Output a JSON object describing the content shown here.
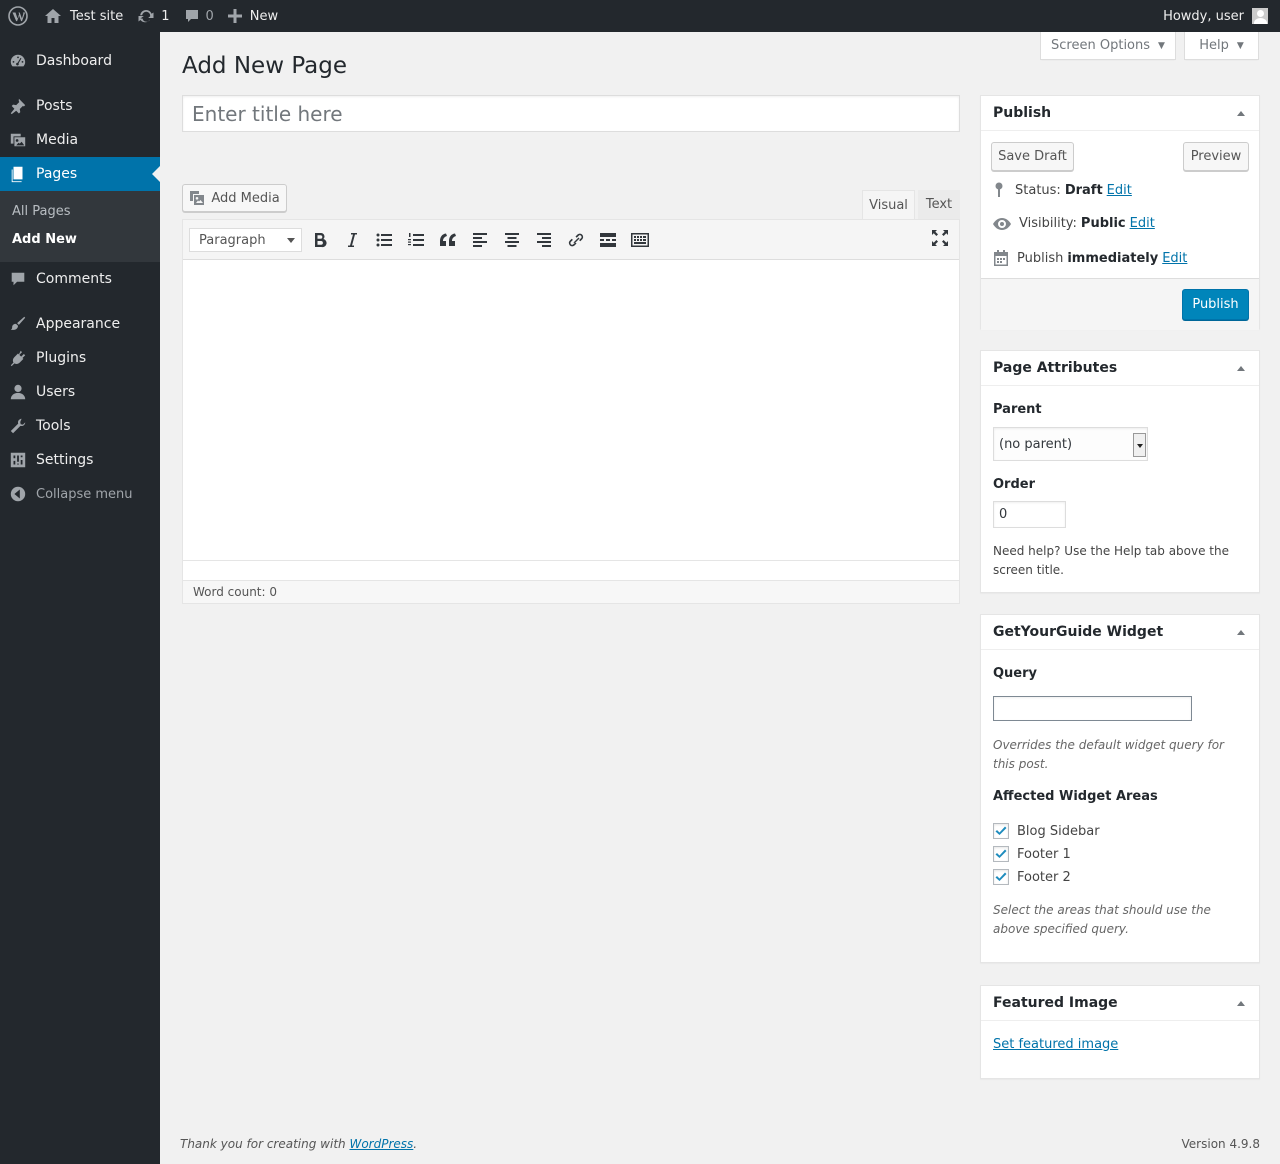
{
  "adminbar": {
    "site_name": "Test site",
    "updates_count": "1",
    "comments_count": "0",
    "new_label": "New",
    "howdy": "Howdy, user"
  },
  "sidebar": {
    "items": [
      {
        "label": "Dashboard",
        "icon": "dashboard-icon"
      },
      {
        "label": "Posts",
        "icon": "pushpin-icon"
      },
      {
        "label": "Media",
        "icon": "media-icon"
      },
      {
        "label": "Pages",
        "icon": "pages-icon",
        "current": true
      },
      {
        "label": "Comments",
        "icon": "comment-icon"
      },
      {
        "label": "Appearance",
        "icon": "paintbrush-icon"
      },
      {
        "label": "Plugins",
        "icon": "plug-icon"
      },
      {
        "label": "Users",
        "icon": "user-icon"
      },
      {
        "label": "Tools",
        "icon": "wrench-icon"
      },
      {
        "label": "Settings",
        "icon": "settings-icon"
      }
    ],
    "submenu": {
      "all_pages": "All Pages",
      "add_new": "Add New"
    },
    "collapse": "Collapse menu"
  },
  "screen_options": "Screen Options",
  "help": "Help",
  "page_title": "Add New Page",
  "title_placeholder": "Enter title here",
  "editor": {
    "add_media": "Add Media",
    "tab_visual": "Visual",
    "tab_text": "Text",
    "format": "Paragraph",
    "word_count": "Word count: 0"
  },
  "publish_box": {
    "title": "Publish",
    "save_draft": "Save Draft",
    "preview": "Preview",
    "status_label": "Status:",
    "status_value": "Draft",
    "visibility_label": "Visibility:",
    "visibility_value": "Public",
    "publish_label": "Publish",
    "publish_value": "immediately",
    "edit": "Edit",
    "publish_button": "Publish"
  },
  "page_attributes": {
    "title": "Page Attributes",
    "parent_label": "Parent",
    "parent_value": "(no parent)",
    "order_label": "Order",
    "order_value": "0",
    "help": "Need help? Use the Help tab above the screen title."
  },
  "gyg_widget": {
    "title": "GetYourGuide Widget",
    "query_label": "Query",
    "query_value": "",
    "query_help": "Overrides the default widget query for this post.",
    "areas_label": "Affected Widget Areas",
    "areas": [
      {
        "label": "Blog Sidebar",
        "checked": true
      },
      {
        "label": "Footer 1",
        "checked": true
      },
      {
        "label": "Footer 2",
        "checked": true
      }
    ],
    "areas_help": "Select the areas that should use the above specified query."
  },
  "featured_image": {
    "title": "Featured Image",
    "link": "Set featured image"
  },
  "footer": {
    "thanks": "Thank you for creating with",
    "wordpress": "WordPress",
    "version": "Version 4.9.8"
  },
  "colors": {
    "accent": "#0073aa",
    "sidebar_bg": "#23282d",
    "publish_btn": "#0085ba"
  }
}
